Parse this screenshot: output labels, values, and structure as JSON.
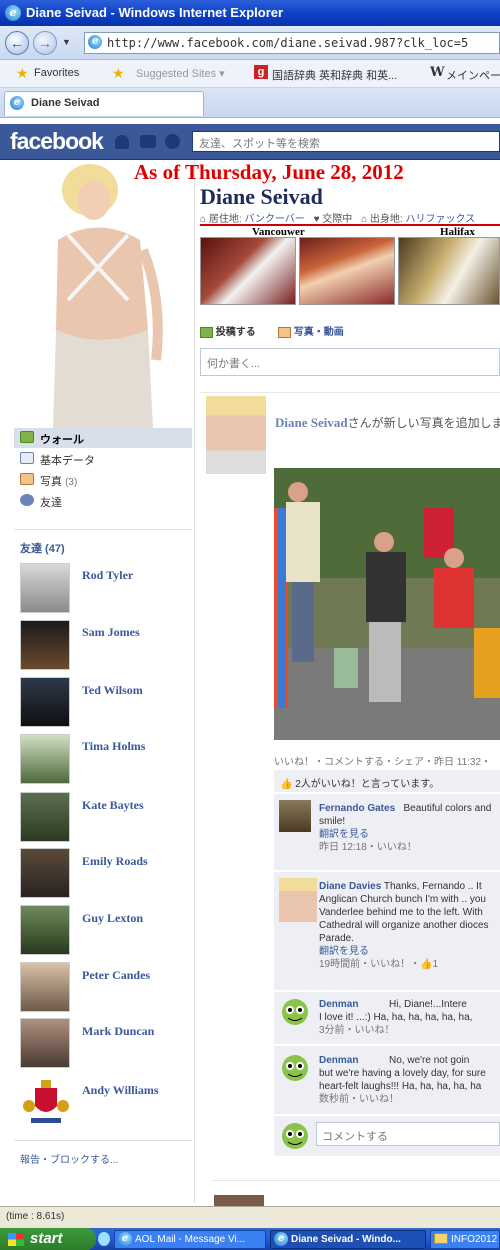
{
  "browser": {
    "window_title": "Diane Seivad  - Windows Internet Explorer",
    "url": "http://www.facebook.com/diane.seivad.987?clk_loc=5",
    "favorites_label": "Favorites",
    "suggested_sites": "Suggested Sites ▾",
    "dictionary_link": "国語辞典 英和辞典 和英...",
    "wiki_link": "メインページ",
    "tab_title": "Diane Seivad"
  },
  "facebook": {
    "logo": "facebook",
    "search_placeholder": "友達、スポット等を検索"
  },
  "profile": {
    "as_of": "As of Thursday, June 28, 2012",
    "name": "Diane Seivad",
    "info_location_label": "居住地:",
    "info_location": "バンクーバー",
    "info_relationship": "交際中",
    "info_hometown_label": "出身地:",
    "info_hometown": "ハリファックス",
    "caption_vancouver": "Vancouwer",
    "caption_halifax": "Halifax"
  },
  "left_menu": {
    "items": [
      {
        "label": "ウォール",
        "count": ""
      },
      {
        "label": "基本データ",
        "count": ""
      },
      {
        "label": "写真",
        "count": "(3)"
      },
      {
        "label": "友達",
        "count": ""
      }
    ],
    "friends_header": "友達 (47)",
    "report_link": "報告・ブロックする..."
  },
  "friends": [
    {
      "name": "Rod Tyler"
    },
    {
      "name": "Sam Jomes"
    },
    {
      "name": "Ted Wilsom"
    },
    {
      "name": "Tima Holms"
    },
    {
      "name": "Kate Baytes"
    },
    {
      "name": "Emily Roads"
    },
    {
      "name": "Guy Lexton"
    },
    {
      "name": "Peter Candes"
    },
    {
      "name": "Mark Duncan"
    },
    {
      "name": "Andy Williams"
    }
  ],
  "composer": {
    "post_tab": "投稿する",
    "photo_tab": "写真・動画",
    "placeholder": "何か書く..."
  },
  "post": {
    "author": "Diane Seivad",
    "action_text": "さんが新しい写真を追加しま",
    "actions": "いいね！・コメントする・シェア・昨日 11:32・",
    "likes": "2人がいいね！と言っています。"
  },
  "comments": [
    {
      "author": "Fernando Gates",
      "text_line1": "Beautiful colors and",
      "text_line2": "smile!",
      "translate": "翻訳を見る",
      "meta": "昨日 12:18・いいね！"
    },
    {
      "author": "Diane Davies",
      "text_line1": "Thanks, Fernando .. It",
      "text_line2": "Anglican Church bunch I'm with .. you",
      "text_line3": "Vanderlee behind me to the left. With",
      "text_line4": "Cathedral will organize another dioces",
      "text_line5": "Parade.",
      "translate": "翻訳を見る",
      "meta": "19時間前・いいね！・👍1"
    },
    {
      "author": "Denman",
      "text_line1": "Hi, Diane!...Intere",
      "text_line2": "I love it! ...:) Ha, ha, ha, ha, ha, ha,",
      "meta": "3分前・いいね！"
    },
    {
      "author": "Denman",
      "text_line1": "No, we're not goin",
      "text_line2": "but we're having a lovely day, for sure",
      "text_line3": "heart-felt laughs!!! Ha, ha, ha, ha, ha",
      "meta": "数秒前・いいね！"
    }
  ],
  "comment_input_placeholder": "コメントする",
  "status_bar": "(time : 8.61s)",
  "taskbar": {
    "start": "start",
    "items": [
      "AOL Mail - Message Vi...",
      "Diane Seivad - Windo...",
      "INFO2012"
    ]
  }
}
